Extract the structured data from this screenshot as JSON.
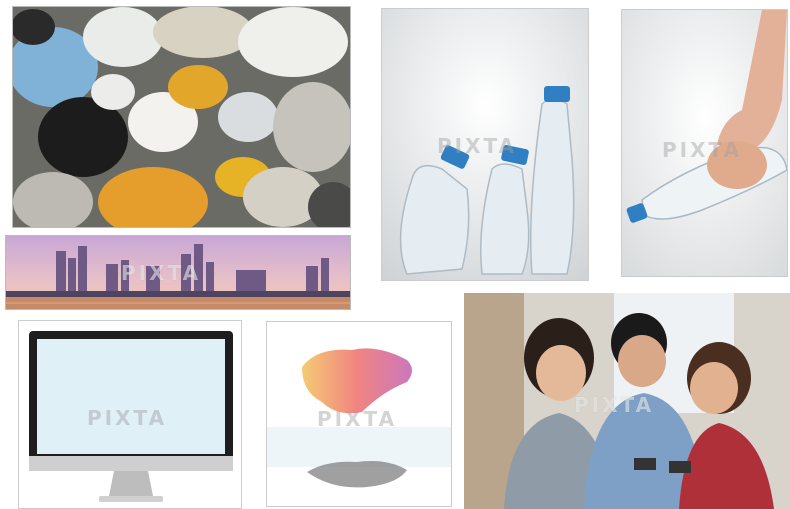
{
  "watermarks": {
    "skyline": "PIXTA",
    "bottles_group": "PIXTA",
    "bottle_hand": "PIXTA",
    "monitor": "PIXTA",
    "map": "PIXTA",
    "friends": "PIXTA"
  }
}
